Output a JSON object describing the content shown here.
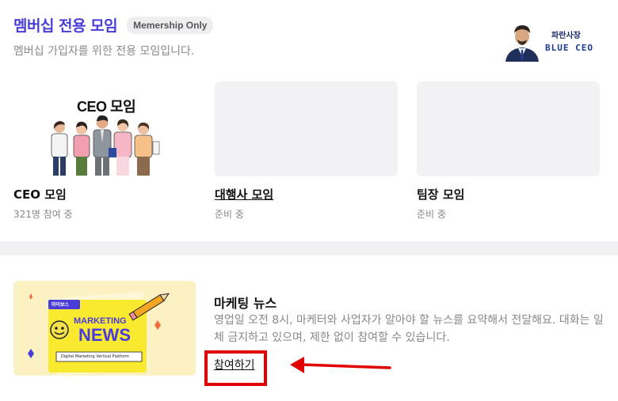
{
  "header": {
    "title": "멤버십 전용 모임",
    "badge": "Memership Only",
    "subtitle": "멤버십 가입자를 위한 전용 모임입니다."
  },
  "logo": {
    "top_text": "파란사장",
    "bottom_text": "BLUE CEO"
  },
  "cards": [
    {
      "image_text": "CEO 모임",
      "title": "CEO 모임",
      "meta": "321명 참여 중"
    },
    {
      "title": "대행사 모임",
      "meta": "준비 중"
    },
    {
      "title": "팀장 모임",
      "meta": "준비 중"
    }
  ],
  "news": {
    "thumb_tag": "마이보스",
    "thumb_line1": "MARKETING",
    "thumb_line2": "NEWS",
    "thumb_footer": "Digital Marketing Vertical Platform",
    "title": "마케팅 뉴스",
    "description": "영업일 오전 8시, 마케터와 사업자가 알아야 할 뉴스를 요약해서 전달해요. 대화는 일체 금지하고 있으며, 제한 없이 참여할 수 있습니다.",
    "join_label": "참여하기"
  },
  "colors": {
    "accent": "#4a3cdb",
    "highlight": "#e10000",
    "news_bg": "#fbf1c3"
  }
}
